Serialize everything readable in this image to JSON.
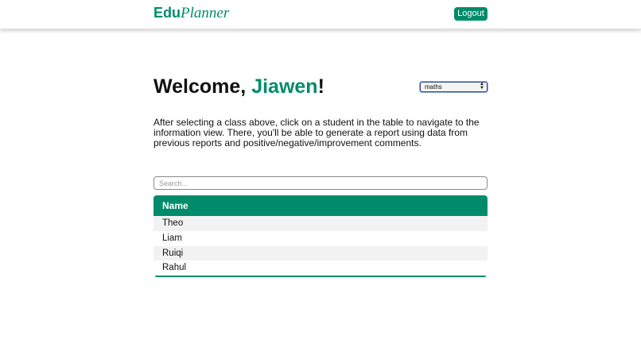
{
  "header": {
    "logo_part1": "Edu",
    "logo_part2": "Planner",
    "logout_label": "Logout"
  },
  "welcome": {
    "greeting": "Welcome, ",
    "username": "Jiawen",
    "punct": "!"
  },
  "class_select": {
    "selected": "maths"
  },
  "intro_text": "After selecting a class above, click on a student in the table to navigate to the information view. There, you'll be able to generate a report using data from previous reports and positive/negative/improvement comments.",
  "search": {
    "placeholder": "Search...",
    "value": ""
  },
  "table": {
    "header": "Name",
    "rows": [
      "Theo",
      "Liam",
      "Ruiqi",
      "Rahul"
    ]
  },
  "colors": {
    "accent": "#008c6b"
  }
}
